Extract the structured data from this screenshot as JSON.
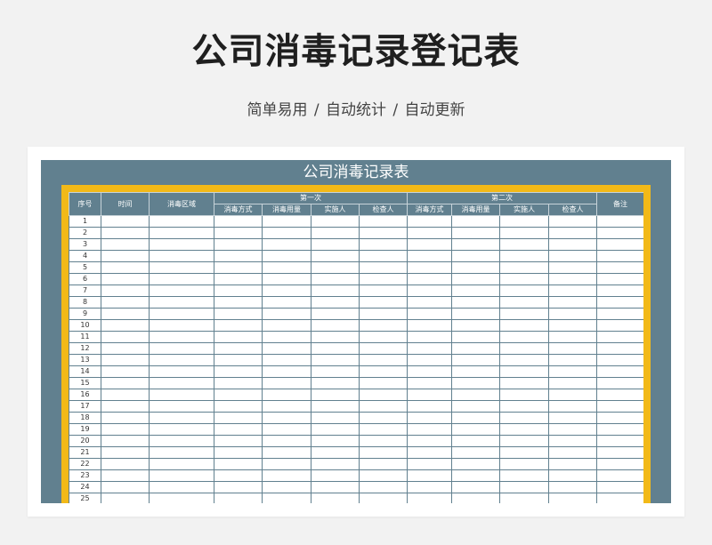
{
  "header": {
    "title": "公司消毒记录登记表",
    "subtitle": "简单易用 / 自动统计 / 自动更新"
  },
  "sheet": {
    "title": "公司消毒记录表",
    "columns": {
      "index": "序号",
      "time": "时间",
      "area": "消毒区域",
      "first_group": "第一次",
      "second_group": "第二次",
      "notes": "备注",
      "sub": [
        "消毒方式",
        "消毒用量",
        "实施人",
        "检查人"
      ]
    },
    "row_numbers": [
      1,
      2,
      3,
      4,
      5,
      6,
      7,
      8,
      9,
      10,
      11,
      12,
      13,
      14,
      15,
      16,
      17,
      18,
      19,
      20,
      21,
      22,
      23,
      24,
      25
    ]
  },
  "colors": {
    "background": "#f2f2f2",
    "sheet": "#61808f",
    "frame": "#f2b918"
  }
}
